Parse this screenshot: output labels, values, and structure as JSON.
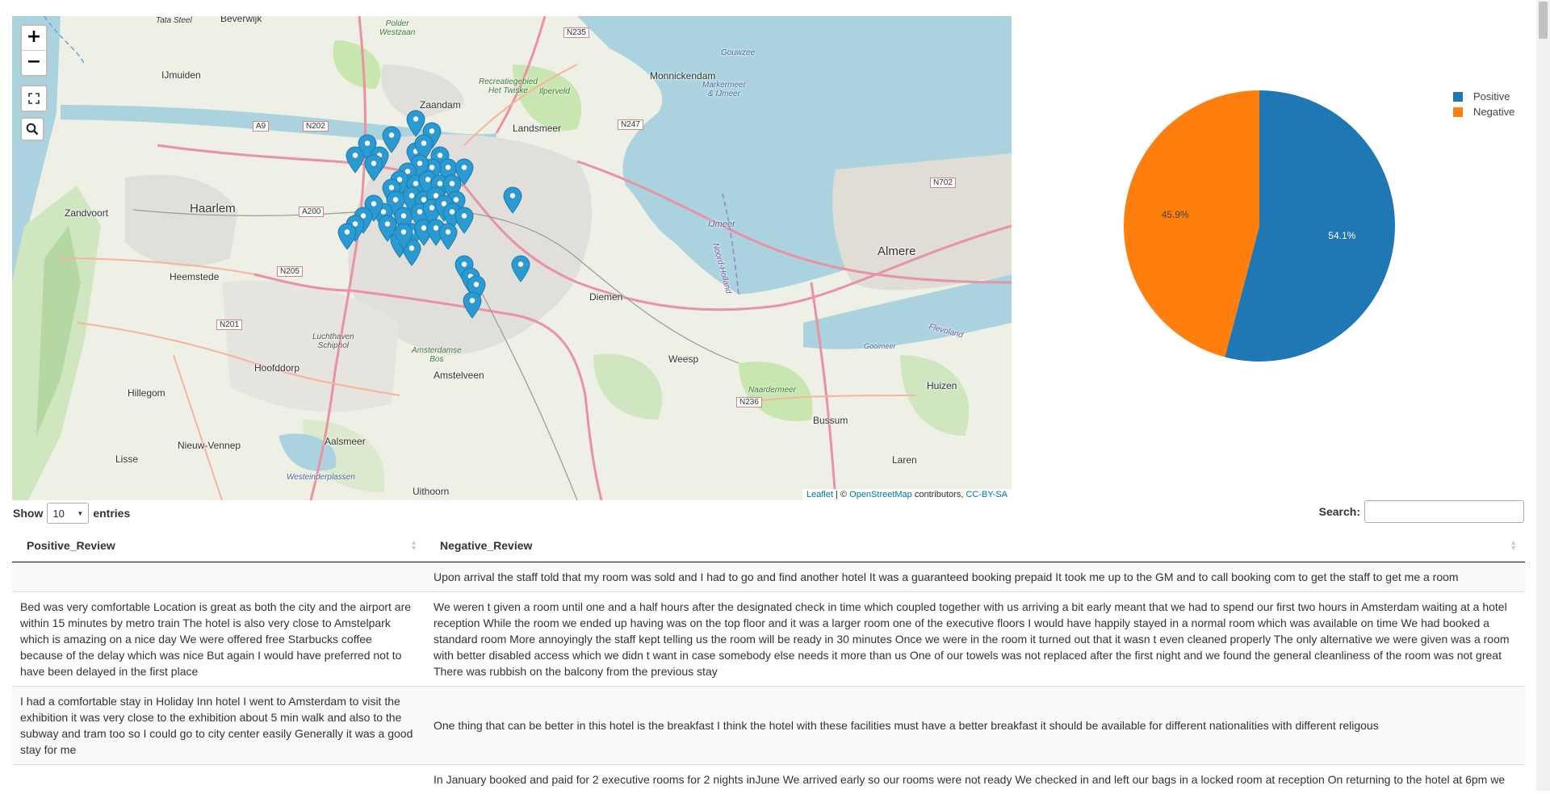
{
  "map": {
    "labels": {
      "tata_steel": "Tata Steel",
      "beverwijk": "Beverwijk",
      "polder": "Polder\nWestzaan",
      "ijmuiden": "IJmuiden",
      "zaandam": "Zaandam",
      "recreatie": "Recreatiegebied\nHet Twiske",
      "ilperveld": "Ilperveld",
      "monnickendam": "Monnickendam",
      "markermeer": "Markermeer\n& IJmeer",
      "gouwzee": "Gouwzee",
      "landsmeer": "Landsmeer",
      "haarlem": "Haarlem",
      "zandvoort": "Zandvoort",
      "heemstede": "Heemstede",
      "ijmeer": "IJmeer",
      "almere": "Almere",
      "diemen": "Diemen",
      "luchthaven": "Luchthaven\nSchiphol",
      "amsterdamse_bos": "Amsterdamse\nBos",
      "hoofddorp": "Hoofddorp",
      "amstelveen": "Amstelveen",
      "weesp": "Weesp",
      "hillegom": "Hillegom",
      "naardermeer": "Naardermeer",
      "huizen": "Huizen",
      "gooimeer": "Gooimeer",
      "flevoland": "Flevoland",
      "nieuw_vennep": "Nieuw-Vennep",
      "aalsmeer": "Aalsmeer",
      "bussum": "Bussum",
      "lisse": "Lisse",
      "laren": "Laren",
      "westeinder": "Westeinderplassen",
      "uithoorn": "Uithoorn",
      "noord_holland": "Noord-Holland"
    },
    "roads": {
      "n235": "N235",
      "a9": "A9",
      "n202": "N202",
      "n247": "N247",
      "a200": "A200",
      "n205": "N205",
      "n201": "N201",
      "n702": "N702",
      "n236": "N236"
    },
    "marker_color": "#2b9ad1",
    "zoom_in": "+",
    "zoom_out": "−",
    "attribution": {
      "leaflet": "Leaflet",
      "sep": " | © ",
      "osm": "OpenStreetMap",
      "contrib": " contributors, ",
      "license": "CC-BY-SA"
    }
  },
  "chart_data": {
    "type": "pie",
    "categories": [
      "Positive",
      "Negative"
    ],
    "values": [
      54.1,
      45.9
    ],
    "labels": [
      "54.1%",
      "45.9%"
    ],
    "colors": [
      "#1f77b4",
      "#ff7f0e"
    ],
    "legend_position": "top-right"
  },
  "table": {
    "length_label_pre": "Show",
    "length_value": "10",
    "length_label_post": "entries",
    "search_label": "Search:",
    "search_value": "",
    "columns": [
      "Positive_Review",
      "Negative_Review"
    ],
    "rows": [
      {
        "positive": "",
        "negative": "Upon arrival the staff told that my room was sold and I had to go and find another hotel It was a guaranteed booking prepaid It took me up to the GM and to call booking com to get the staff to get me a room"
      },
      {
        "positive": "Bed was very comfortable Location is great as both the city and the airport are within 15 minutes by metro train The hotel is also very close to Amstelpark which is amazing on a nice day We were offered free Starbucks coffee because of the delay which was nice But again I would have preferred not to have been delayed in the first place",
        "negative": "We weren t given a room until one and a half hours after the designated check in time which coupled together with us arriving a bit early meant that we had to spend our first two hours in Amsterdam waiting at a hotel reception While the room we ended up having was on the top floor and it was a larger room one of the executive floors I would have happily stayed in a normal room which was available on time We had booked a standard room More annoyingly the staff kept telling us the room will be ready in 30 minutes Once we were in the room it turned out that it wasn t even cleaned properly The only alternative we were given was a room with better disabled access which we didn t want in case somebody else needs it more than us One of our towels was not replaced after the first night and we found the general cleanliness of the room was not great There was rubbish on the balcony from the previous stay"
      },
      {
        "positive": "I had a comfortable stay in Holiday Inn hotel I went to Amsterdam to visit the exhibition it was very close to the exhibition about 5 min walk and also to the subway and tram too so I could go to city center easily Generally it was a good stay for me",
        "negative": "One thing that can be better in this hotel is the breakfast I think the hotel with these facilities must have a better breakfast it should be available for different nationalities with different religous"
      },
      {
        "positive": "",
        "negative": "In January booked and paid for 2 executive rooms for 2 nights inJune We arrived early so our rooms were not ready We checked in and left our bags in a locked room at reception On returning to the hotel at 6pm we"
      }
    ]
  }
}
